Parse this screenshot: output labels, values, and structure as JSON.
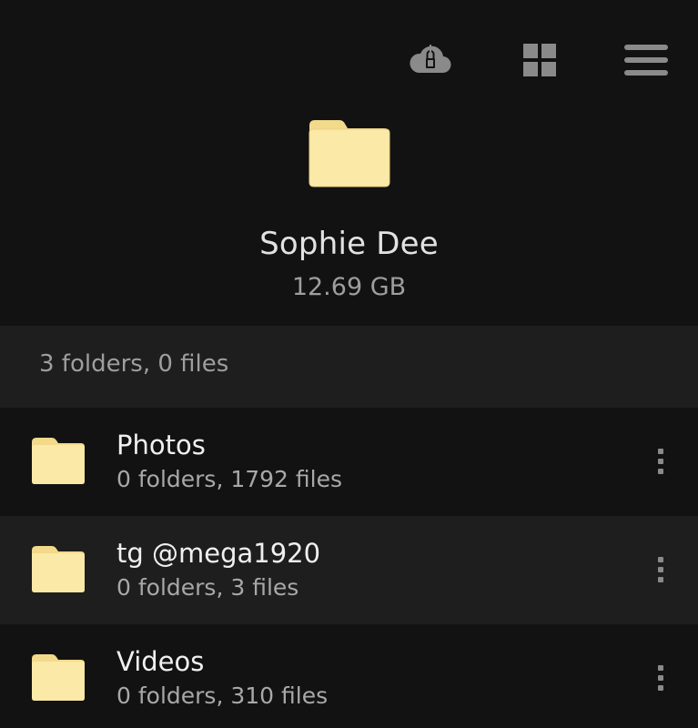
{
  "toolbar": {
    "icons": [
      "cloud-lock-icon",
      "grid-view-icon",
      "hamburger-menu-icon"
    ]
  },
  "header": {
    "title": "Sophie Dee",
    "size": "12.69 GB",
    "folder_color": "#fbe9a8"
  },
  "summary": {
    "text": "3 folders, 0 files"
  },
  "folders": [
    {
      "name": "Photos",
      "meta": "0 folders, 1792 files"
    },
    {
      "name": "tg @mega1920",
      "meta": "0 folders, 3 files"
    },
    {
      "name": "Videos",
      "meta": "0 folders, 310 files"
    }
  ],
  "colors": {
    "background": "#121212",
    "row_alt": "#1e1e1e",
    "icon_gray": "#8a8a8a",
    "folder_body": "#fbe9a8",
    "folder_tab": "#f3d98a"
  }
}
